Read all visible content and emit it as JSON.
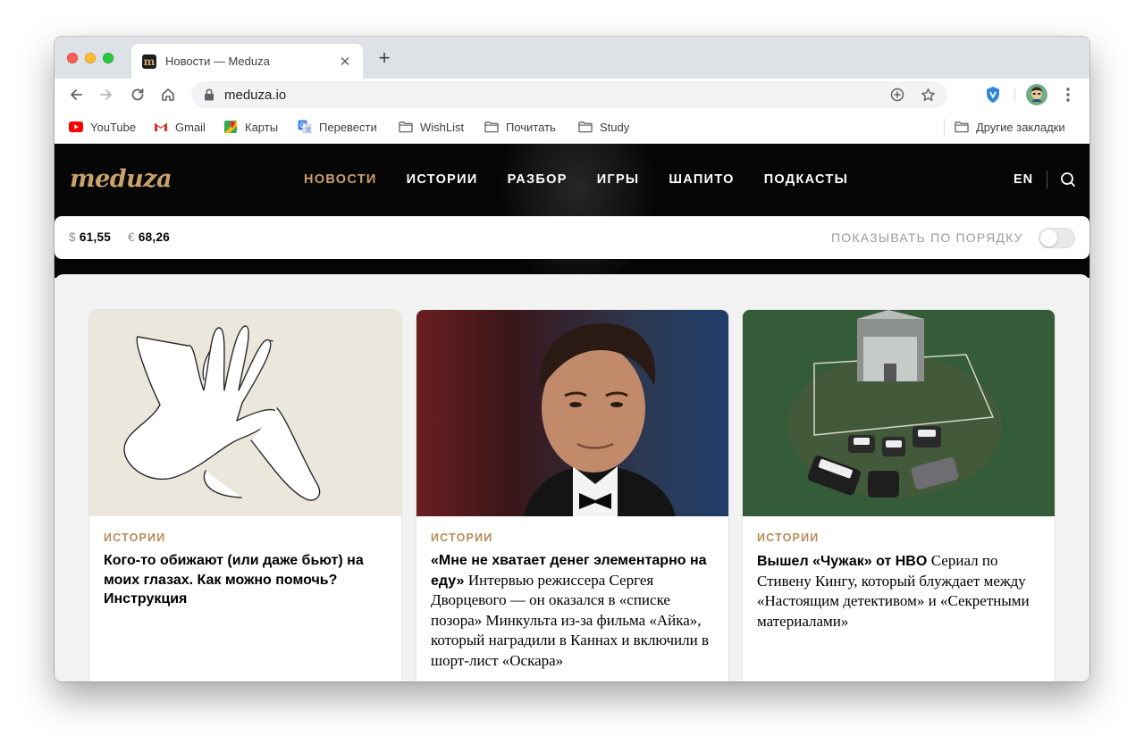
{
  "browser": {
    "tab_title": "Новости — Meduza",
    "tab_favicon": "m",
    "url": "meduza.io"
  },
  "bookmarks": [
    {
      "label": "YouTube",
      "icon": "youtube-icon"
    },
    {
      "label": "Gmail",
      "icon": "gmail-icon"
    },
    {
      "label": "Карты",
      "icon": "maps-icon"
    },
    {
      "label": "Перевести",
      "icon": "translate-icon"
    },
    {
      "label": "WishList",
      "icon": "folder-icon"
    },
    {
      "label": "Почитать",
      "icon": "folder-icon"
    },
    {
      "label": "Study",
      "icon": "folder-icon"
    }
  ],
  "other_bookmarks": "Другие закладки",
  "site": {
    "logo": "meduza",
    "nav": [
      "НОВОСТИ",
      "ИСТОРИИ",
      "РАЗБОР",
      "ИГРЫ",
      "ШАПИТО",
      "ПОДКАСТЫ"
    ],
    "active_nav": "НОВОСТИ",
    "lang": "EN",
    "accent_color": "#c9a16a"
  },
  "rates": {
    "usd_symbol": "$",
    "usd": "61,55",
    "eur_symbol": "€",
    "eur": "68,26"
  },
  "order_toggle_label": "ПОКАЗЫВАТЬ ПО ПОРЯДКУ",
  "order_toggle_on": false,
  "cards": [
    {
      "rubric": "ИСТОРИИ",
      "title_strong": "Кого-то обижают (или даже бьют) на моих глазах. Как можно помочь? Инструкция",
      "title_rest": ""
    },
    {
      "rubric": "ИСТОРИИ",
      "title_strong": "«Мне не хватает денег элементарно на еду»",
      "title_rest": "Интервью режиссера Сергея Дворцевого — он оказался в «списке позора» Минкульта из-за фильма «Айка», который наградили в Каннах и включили в шорт-лист «Оскара»"
    },
    {
      "rubric": "ИСТОРИИ",
      "title_strong": "Вышел «Чужак» от HBO",
      "title_rest": "Сериал по Стивену Кингу, который блуждает между «Настоящим детективом» и «Секретными материалами»"
    }
  ]
}
